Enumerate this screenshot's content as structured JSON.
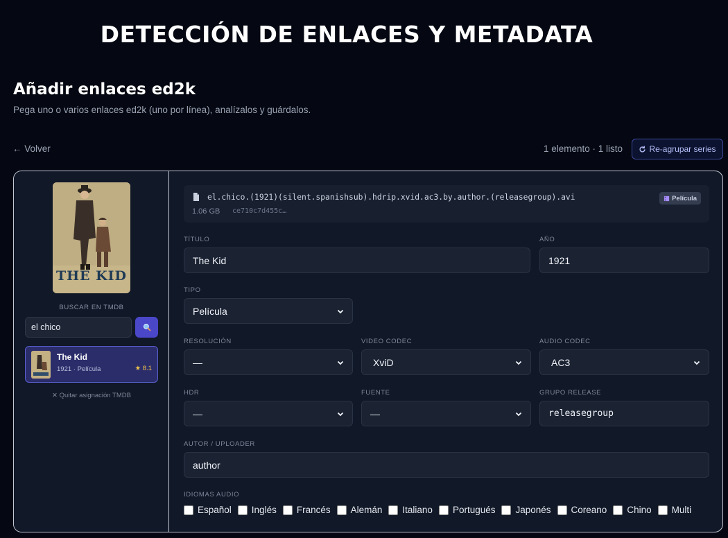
{
  "banner": "DETECCIÓN DE ENLACES Y METADATA",
  "header": {
    "title": "Añadir enlaces ed2k",
    "subtitle": "Pega uno o varios enlaces ed2k (uno por línea), analízalos y guárdalos."
  },
  "toolbar": {
    "back_label": "← Volver",
    "count": "1 elemento · 1 listo",
    "regroup_label": "Re-agrupar series"
  },
  "sidebar": {
    "search_label": "BUSCAR EN TMDB",
    "search_value": "el chico",
    "result": {
      "title": "The Kid",
      "meta": "1921 · Película",
      "rating": "★ 8.1"
    },
    "unassign_label": "✕ Quitar asignación TMDB",
    "poster_text": "THE KID"
  },
  "file": {
    "name": "el.chico.(1921)(silent.spanishsub).hdrip.xvid.ac3.by.author.(releasegroup).avi",
    "size": "1.06 GB",
    "hash": "ce710c7d455c…",
    "badge": "Película"
  },
  "form": {
    "titulo": {
      "label": "TÍTULO",
      "value": "The Kid"
    },
    "anio": {
      "label": "AÑO",
      "value": "1921"
    },
    "tipo": {
      "label": "TIPO",
      "value": "Película"
    },
    "resolucion": {
      "label": "RESOLUCIÓN",
      "value": "—"
    },
    "video_codec": {
      "label": "VIDEO CODEC",
      "value": "XviD"
    },
    "audio_codec": {
      "label": "AUDIO CODEC",
      "value": "AC3"
    },
    "hdr": {
      "label": "HDR",
      "value": "—"
    },
    "fuente": {
      "label": "FUENTE",
      "value": "—"
    },
    "grupo_release": {
      "label": "GRUPO RELEASE",
      "value": "releasegroup"
    },
    "autor": {
      "label": "AUTOR / UPLOADER",
      "value": "author"
    },
    "idiomas": {
      "label": "IDIOMAS AUDIO",
      "options": [
        "Español",
        "Inglés",
        "Francés",
        "Alemán",
        "Italiano",
        "Portugués",
        "Japonés",
        "Coreano",
        "Chino",
        "Multi"
      ]
    }
  },
  "colors": {
    "accent": "#4b47c9",
    "background": "#050812",
    "card": "#111827"
  }
}
